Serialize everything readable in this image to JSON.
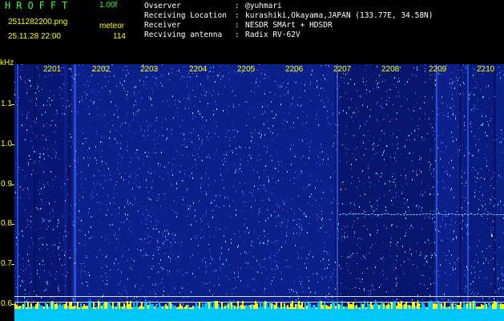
{
  "header": {
    "app_name": "HROFFT",
    "app_version": "1.00f",
    "filename": "2511282200.png",
    "mode": "meteor",
    "datetime": "25.11.28 22:00",
    "count": "114",
    "info": [
      {
        "label": "Ovserver",
        "sep": ":",
        "value": "@yuhmari"
      },
      {
        "label": "Receiving Location",
        "sep": ":",
        "value": "kurashiki,Okayama,JAPAN (133.77E, 34.58N)"
      },
      {
        "label": "Receiver",
        "sep": ":",
        "value": "NESDR SMArt + HDSDR"
      },
      {
        "label": "Recviving antenna",
        "sep": ":",
        "value": "Radix RV-62V"
      }
    ]
  },
  "spectrogram": {
    "unit_label": "kHz",
    "time_labels": [
      "2201",
      "2202",
      "2203",
      "2204",
      "2205",
      "2206",
      "2207",
      "2208",
      "2209",
      "2210"
    ],
    "freq_labels": [
      "1.1",
      "1.0",
      "0.9",
      "0.8",
      "0.7",
      "0.6"
    ],
    "colors": {
      "background": "#0c1f8a",
      "accent_text": "#ffff00",
      "title_text": "#33ff33",
      "marker_lines": "#ffffff",
      "noise_bright": "#4fd0ff",
      "bottom_band": "#00c8ff"
    }
  }
}
